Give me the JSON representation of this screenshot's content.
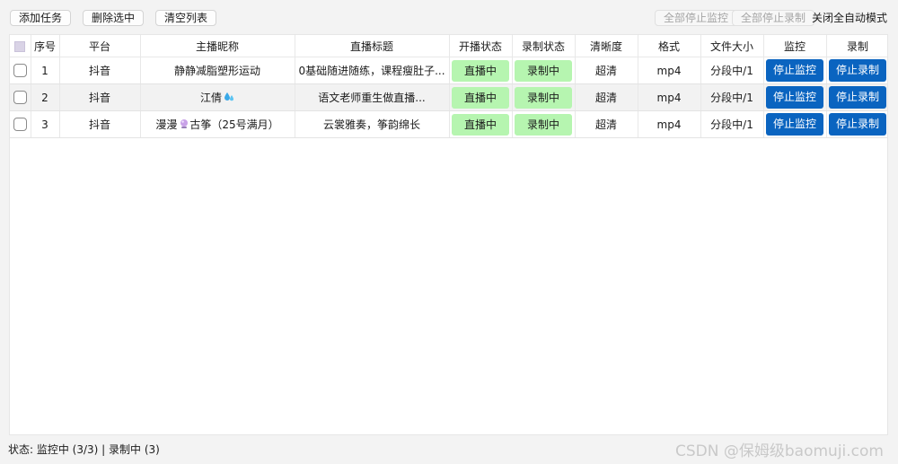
{
  "toolbar": {
    "add_task": "添加任务",
    "delete_selected": "删除选中",
    "clear_list": "清空列表",
    "stop_all_monitor": "全部停止监控",
    "stop_all_record": "全部停止录制",
    "close_auto_mode": "关闭全自动模式"
  },
  "table": {
    "headers": [
      "",
      "序号",
      "平台",
      "主播昵称",
      "直播标题",
      "开播状态",
      "录制状态",
      "清晰度",
      "格式",
      "文件大小",
      "监控",
      "录制"
    ],
    "rows": [
      {
        "index": "1",
        "platform": "抖音",
        "nickname": "静静减脂塑形运动",
        "nickname_icon": "",
        "nickname_suffix": "",
        "title": "0基础随进随练，课程瘦肚子...",
        "live_status": "直播中",
        "record_status": "录制中",
        "quality": "超清",
        "format": "mp4",
        "file_size": "分段中/1",
        "monitor_btn": "停止监控",
        "record_btn": "停止录制"
      },
      {
        "index": "2",
        "platform": "抖音",
        "nickname": "江倩",
        "nickname_icon": "water-drops-emoji",
        "nickname_suffix": "",
        "title": "语文老师重生做直播...",
        "live_status": "直播中",
        "record_status": "录制中",
        "quality": "超清",
        "format": "mp4",
        "file_size": "分段中/1",
        "monitor_btn": "停止监控",
        "record_btn": "停止录制"
      },
      {
        "index": "3",
        "platform": "抖音",
        "nickname": "漫漫",
        "nickname_icon": "crystal-ball-emoji",
        "nickname_suffix": "古筝（25号满月）",
        "title": "云裳雅奏，筝韵绵长",
        "live_status": "直播中",
        "record_status": "录制中",
        "quality": "超清",
        "format": "mp4",
        "file_size": "分段中/1",
        "monitor_btn": "停止监控",
        "record_btn": "停止录制"
      }
    ]
  },
  "status_bar": "状态: 监控中 (3/3) | 录制中 (3)",
  "watermark": "CSDN @保姆级baomuji.com",
  "colors": {
    "live_badge": "#b6f5b0",
    "action_button": "#0a64c0",
    "alt_row": "#f2f2f2"
  }
}
